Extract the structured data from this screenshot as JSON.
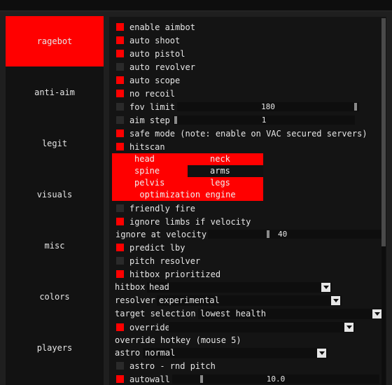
{
  "sidebar": {
    "tabs": [
      {
        "label": "ragebot",
        "active": true
      },
      {
        "label": "anti-aim",
        "active": false
      },
      {
        "label": "legit",
        "active": false
      },
      {
        "label": "visuals",
        "active": false
      },
      {
        "label": "misc",
        "active": false
      },
      {
        "label": "colors",
        "active": false
      },
      {
        "label": "players",
        "active": false
      }
    ]
  },
  "colors": {
    "accent": "#ff0000",
    "background": "#141414",
    "checkbox_off": "#2a2a2a"
  },
  "ragebot": {
    "enable_aimbot": {
      "label": "enable aimbot",
      "checked": true
    },
    "auto_shoot": {
      "label": "auto shoot",
      "checked": true
    },
    "auto_pistol": {
      "label": "auto pistol",
      "checked": true
    },
    "auto_revolver": {
      "label": "auto revolver",
      "checked": false
    },
    "auto_scope": {
      "label": "auto scope",
      "checked": true
    },
    "no_recoil": {
      "label": "no recoil",
      "checked": true
    },
    "fov_limit": {
      "label": "fov limit",
      "checked": false,
      "value": "180",
      "fraction": 1.0
    },
    "aim_step": {
      "label": "aim step",
      "checked": false,
      "value": "1",
      "fraction": 0.0
    },
    "safe_mode": {
      "label": "safe mode (note: enable on VAC secured servers)",
      "checked": true
    },
    "hitscan": {
      "label": "hitscan",
      "checked": true
    },
    "hitscan_options": {
      "head": {
        "label": "head",
        "selected": true
      },
      "neck": {
        "label": "neck",
        "selected": true
      },
      "spine": {
        "label": "spine",
        "selected": true
      },
      "arms": {
        "label": "arms",
        "selected": false
      },
      "pelvis": {
        "label": "pelvis",
        "selected": true
      },
      "legs": {
        "label": "legs",
        "selected": true
      },
      "optimization_engine": {
        "label": "optimization engine",
        "selected": true
      }
    },
    "friendly_fire": {
      "label": "friendly fire",
      "checked": false
    },
    "ignore_limbs": {
      "label": "ignore limbs if velocity",
      "checked": true
    },
    "ignore_at_velocity": {
      "label": "ignore at velocity",
      "value": "40",
      "fraction": 0.32
    },
    "predict_lby": {
      "label": "predict lby",
      "checked": true
    },
    "pitch_resolver": {
      "label": "pitch resolver",
      "checked": false
    },
    "hitbox_prioritized": {
      "label": "hitbox prioritized",
      "checked": true
    },
    "hitbox": {
      "label": "hitbox",
      "value": "head"
    },
    "resolver": {
      "label": "resolver",
      "value": "experimental"
    },
    "target_selection": {
      "label": "target selection",
      "value": "lowest health"
    },
    "override_set": {
      "label": "override set",
      "checked": true
    },
    "override_hotkey": {
      "label": "override hotkey (mouse 5)"
    },
    "astro": {
      "label": "astro",
      "value": "normal"
    },
    "astro_rnd_pitch": {
      "label": "astro - rnd pitch",
      "checked": false
    },
    "autowall": {
      "label": "autowall",
      "checked": true,
      "value": "10.0"
    }
  }
}
